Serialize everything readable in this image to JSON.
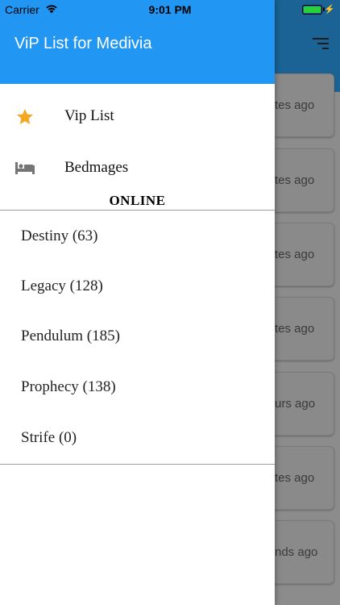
{
  "status_bar": {
    "carrier": "Carrier",
    "time": "9:01 PM"
  },
  "background": {
    "cards": [
      "tes ago",
      "tes ago",
      "tes ago",
      "tes ago",
      "urs ago",
      "tes ago",
      "nds ago"
    ]
  },
  "drawer": {
    "title": "ViP List for Medivia",
    "header_color": "#2196f3",
    "menu": [
      {
        "label": "Vip List",
        "icon": "star-icon",
        "icon_color": "#f5a623"
      },
      {
        "label": "Bedmages",
        "icon": "bed-icon",
        "icon_color": "#757575"
      }
    ],
    "section_title": "ONLINE",
    "servers": [
      {
        "label": "Destiny (63)"
      },
      {
        "label": "Legacy (128)"
      },
      {
        "label": "Pendulum (185)"
      },
      {
        "label": "Prophecy (138)"
      },
      {
        "label": "Strife (0)"
      }
    ]
  }
}
